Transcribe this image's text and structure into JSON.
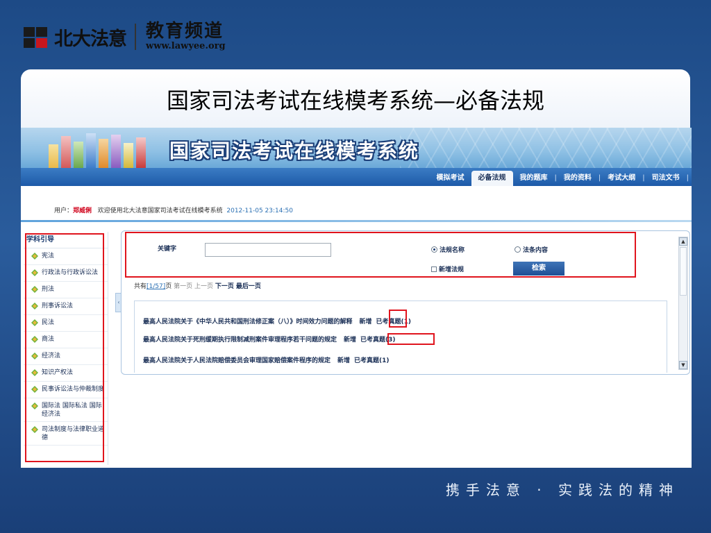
{
  "brand": {
    "name": "北大法意",
    "channel_title": "教育频道",
    "channel_url": "www.lawyee.org"
  },
  "slide_title": "国家司法考试在线模考系统—必备法规",
  "app": {
    "banner_title": "国家司法考试在线模考系统",
    "nav": [
      "模拟考试",
      "必备法规",
      "我的题库",
      "我的资料",
      "考试大纲",
      "司法文书"
    ],
    "nav_active": "必备法规",
    "user_label": "用户：",
    "user_name": "郑威俐",
    "welcome": "欢迎使用北大法意国家司法考试在线模考系统",
    "timestamp": "2012-11-05 23:14:50"
  },
  "sidebar": {
    "heading": "学科引导",
    "items": [
      "宪法",
      "行政法与行政诉讼法",
      "刑法",
      "刑事诉讼法",
      "民法",
      "商法",
      "经济法",
      "知识产权法",
      "民事诉讼法与仲裁制度",
      "国际法 国际私法 国际经济法",
      "司法制度与法律职业道德"
    ]
  },
  "search": {
    "keyword_label": "关键字",
    "keyword_value": "",
    "option_name": "法规名称",
    "option_content": "法条内容",
    "selected_option": "法规名称",
    "new_laws_label": "新增法规",
    "button_label": "检索"
  },
  "pager": {
    "prefix": "共有",
    "page_info": "[1/57]",
    "suffix": "页",
    "first": "第一页",
    "prev": "上一页",
    "next": "下一页",
    "last": "最后一页"
  },
  "results": [
    {
      "title": "最高人民法院关于《中华人民共和国刑法修正案（八）》时间效力问题的解释",
      "tag": "新增",
      "exam": "已考真题(1)"
    },
    {
      "title": "最高人民法院关于死刑缓期执行限制减刑案件审理程序若干问题的规定",
      "tag": "新增",
      "exam": "已考真题(3)"
    },
    {
      "title": "最高人民法院关于人民法院赔偿委员会审理国家赔偿案件程序的规定",
      "tag": "新增",
      "exam": "已考真题(1)"
    }
  ],
  "slogan": "携手法意 · 实践法的精神",
  "colors": {
    "highlight_box": "#e0141d",
    "nav_bar": "#1d5aa8",
    "user_name": "#d0021b"
  }
}
